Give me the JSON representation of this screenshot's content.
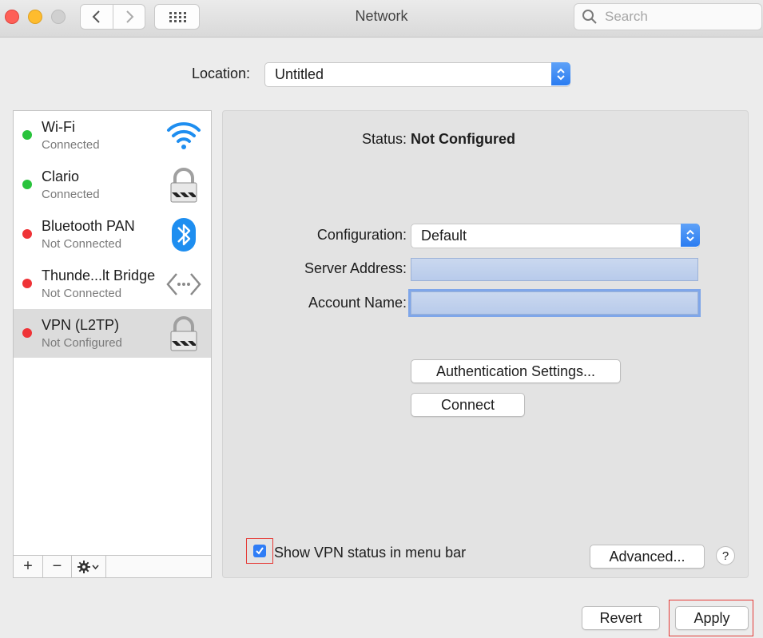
{
  "window": {
    "title": "Network",
    "search_placeholder": "Search"
  },
  "location": {
    "label": "Location:",
    "value": "Untitled"
  },
  "services": [
    {
      "name": "Wi-Fi",
      "status": "Connected",
      "status_color": "#29c33c",
      "icon": "wifi-icon"
    },
    {
      "name": "Clario",
      "status": "Connected",
      "status_color": "#29c33c",
      "icon": "lock-icon"
    },
    {
      "name": "Bluetooth PAN",
      "status": "Not Connected",
      "status_color": "#ef3337",
      "icon": "bluetooth-icon"
    },
    {
      "name": "Thunde...lt Bridge",
      "status": "Not Connected",
      "status_color": "#ef3337",
      "icon": "thunderbolt-bridge-icon"
    },
    {
      "name": "VPN (L2TP)",
      "status": "Not Configured",
      "status_color": "#ef3337",
      "icon": "lock-icon",
      "selected": true
    }
  ],
  "sidebar_tools": {
    "add": "+",
    "remove": "−"
  },
  "detail": {
    "status_label": "Status:",
    "status_value": "Not Configured",
    "configuration_label": "Configuration:",
    "configuration_value": "Default",
    "server_address_label": "Server Address:",
    "server_address_value": "",
    "account_name_label": "Account Name:",
    "account_name_value": "",
    "auth_settings_button": "Authentication Settings...",
    "connect_button": "Connect",
    "show_vpn_status_label": "Show VPN status in menu bar",
    "show_vpn_status_checked": true,
    "advanced_button": "Advanced...",
    "help_button": "?"
  },
  "footer": {
    "revert_button": "Revert",
    "apply_button": "Apply"
  },
  "colors": {
    "accent": "#2f7df6",
    "connected": "#29c33c",
    "disconnected": "#ef3337",
    "highlight_box": "#e53935"
  }
}
